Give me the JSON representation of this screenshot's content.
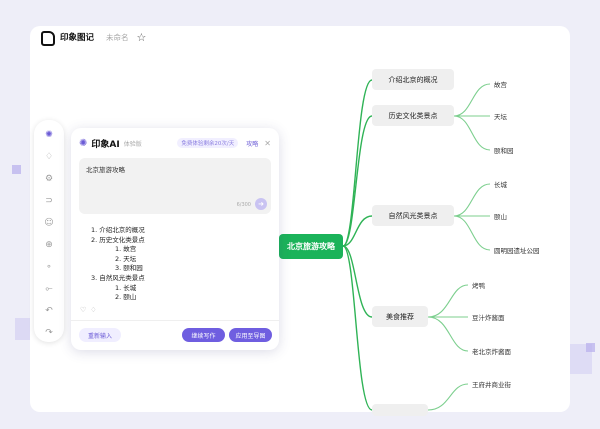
{
  "header": {
    "app_title": "印象图记",
    "doc_name": "未命名"
  },
  "toolbar": {
    "items": [
      "ai-icon",
      "bulb-icon",
      "node-icon",
      "link-icon",
      "style-icon",
      "add-icon",
      "dot-icon",
      "relation-icon",
      "undo-icon",
      "redo-icon"
    ]
  },
  "ai_panel": {
    "title": "印象AI",
    "badge": "体验版",
    "quota": "免费体验剩余20次/天",
    "guide": "攻略",
    "input_value": "北京旅游攻略",
    "counter": "6/300",
    "result_lines": [
      {
        "text": "1. 介绍北京的概况",
        "level": 1
      },
      {
        "text": "2. 历史文化类景点",
        "level": 1
      },
      {
        "text": "1. 故宫",
        "level": 2
      },
      {
        "text": "2. 天坛",
        "level": 2
      },
      {
        "text": "3. 颐和园",
        "level": 2
      },
      {
        "text": "3. 自然风光类景点",
        "level": 1
      },
      {
        "text": "1. 长城",
        "level": 2
      },
      {
        "text": "2. 颐山",
        "level": 2
      }
    ],
    "buttons": {
      "reinput": "重新输入",
      "continue": "继续写作",
      "apply": "应用至导图"
    }
  },
  "mindmap": {
    "root": "北京旅游攻略",
    "branches": [
      {
        "label": "介绍北京的概况",
        "children": []
      },
      {
        "label": "历史文化类景点",
        "children": [
          "故宫",
          "天坛",
          "颐和园"
        ]
      },
      {
        "label": "自然风光类景点",
        "children": [
          "长城",
          "颐山",
          "圆明园遗址公园"
        ]
      },
      {
        "label": "美食推荐",
        "children": [
          "烤鸭",
          "豆汁炸酱面",
          "老北京炸酱面"
        ]
      },
      {
        "label": "",
        "children": [
          "王府井商业街"
        ]
      }
    ]
  },
  "colors": {
    "accent": "#6f5ee0",
    "root": "#1bb35a",
    "branch_line": "#2fb356",
    "leaf_line": "#7ccf8e"
  }
}
